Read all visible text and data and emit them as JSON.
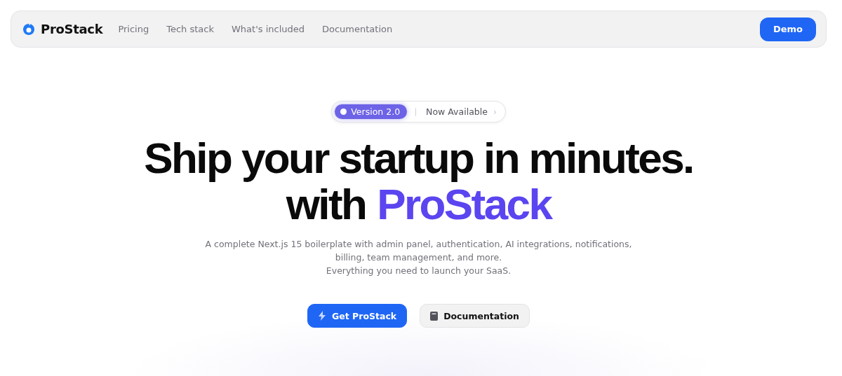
{
  "nav": {
    "brand": "ProStack",
    "links": [
      "Pricing",
      "Tech stack",
      "What's included",
      "Documentation"
    ],
    "cta": "Demo"
  },
  "announcement": {
    "badge": "Version 2.0",
    "text": "Now Available",
    "chevron": "›"
  },
  "heading": {
    "line1": "Ship your startup in minutes.",
    "line2": "with",
    "highlight": "ProStack"
  },
  "description": "A complete Next.js 15 boilerplate with admin panel, authentication, AI integrations, notifications, billing, team management, and more.",
  "tagline": "Everything you need to launch your SaaS.",
  "buttons": [
    {
      "kind": "primary",
      "label": "Get ProStack"
    },
    {
      "kind": "secondary",
      "label": "Documentation"
    }
  ]
}
